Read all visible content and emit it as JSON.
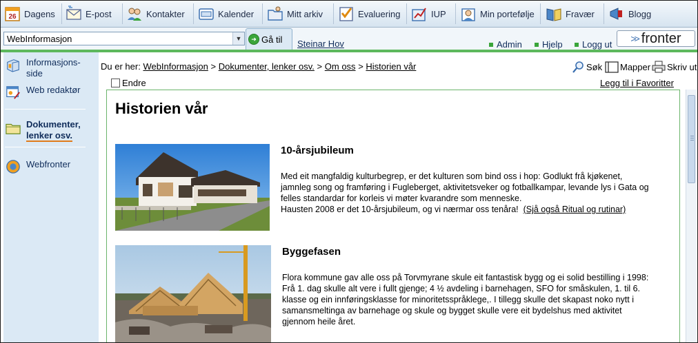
{
  "toolbar": {
    "items": [
      {
        "label": "Dagens",
        "icon": "calendar-day-icon"
      },
      {
        "label": "E-post",
        "icon": "mail-icon"
      },
      {
        "label": "Kontakter",
        "icon": "contacts-icon"
      },
      {
        "label": "Kalender",
        "icon": "calendar-icon"
      },
      {
        "label": "Mitt arkiv",
        "icon": "archive-icon"
      },
      {
        "label": "Evaluering",
        "icon": "evaluation-icon"
      },
      {
        "label": "IUP",
        "icon": "iup-icon"
      },
      {
        "label": "Min portefølje",
        "icon": "portfolio-icon"
      },
      {
        "label": "Fravær",
        "icon": "absence-icon"
      },
      {
        "label": "Blogg",
        "icon": "blog-icon"
      }
    ],
    "dagens_number": "26"
  },
  "header": {
    "site_select": "WebInformasjon",
    "goto_label": "Gå til",
    "username": "Steinar Hov",
    "admin": "Admin",
    "help": "Hjelp",
    "logout": "Logg ut",
    "logo_text": "fronter",
    "logo_arrows": ">>"
  },
  "sidebar": {
    "items": [
      {
        "label_line1": "Informasjons-",
        "label_line2": "side"
      },
      {
        "label_line1": "Web redaktør"
      },
      {
        "label_line1": "Dokumenter,",
        "label_line2": "lenker osv."
      },
      {
        "label_line1": "Webfronter"
      }
    ]
  },
  "breadcrumb": {
    "prefix": "Du er her:",
    "crumbs": [
      "WebInformasjon",
      "Dokumenter, lenker osv.",
      "Om oss",
      "Historien vår"
    ],
    "separator": ">"
  },
  "tools": {
    "search": "Søk",
    "folders": "Mapper",
    "print": "Skriv ut"
  },
  "edit_label": "Endre",
  "favorites_link": "Legg til i Favoritter",
  "content": {
    "title": "Historien vår",
    "sections": [
      {
        "heading": "10-årsjubileum",
        "lines": [
          "Med eit mangfaldig kulturbegrep, er det kulturen som bind oss i hop: Godlukt frå kjøkenet,",
          "jamnleg song og framføring i Fugleberget, aktivitetsveker og fotballkampar, levande lys i Gata og",
          "felles standardar for korleis vi møter kvarandre som menneske."
        ],
        "last_line": "Hausten 2008 er det 10-årsjubileum, og vi nærmar oss tenåra!",
        "link": "(Sjå også Ritual og rutinar)"
      },
      {
        "heading": "Byggefasen",
        "lines": [
          "Flora kommune gav alle oss på Torvmyrane skule eit fantastisk bygg og ei solid bestilling i 1998:",
          "Frå 1. dag skulle alt vere i fullt gjenge; 4 ½ avdeling i barnehagen, SFO for småskulen, 1. til 6.",
          "klasse og ein innføringsklasse for minoritetsspråklege,. I tillegg skulle det skapast noko nytt i",
          "samansmeltinga av barnehage og skule og bygget skulle vere eit bydelshus med aktivitet",
          "gjennom heile året."
        ]
      }
    ]
  },
  "colors": {
    "accent_green": "#5db85d",
    "sidebar_bg": "#dbe9f5",
    "active_underline": "#e07b1a"
  }
}
